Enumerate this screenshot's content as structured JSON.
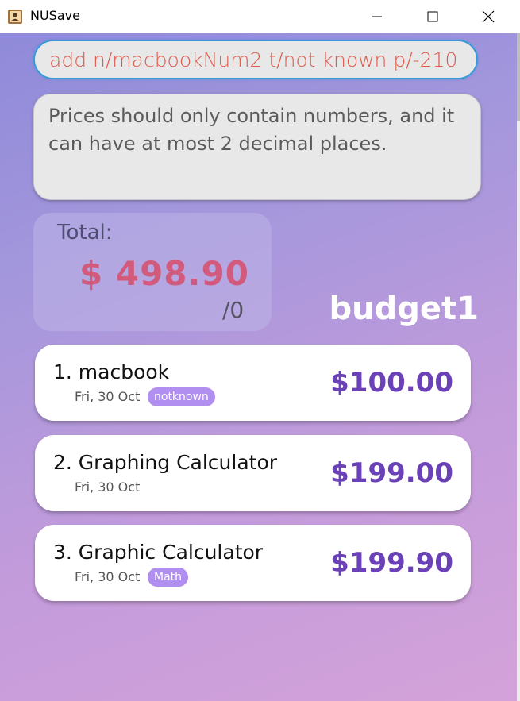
{
  "window": {
    "title": "NUSave",
    "icon": "contact-book-icon",
    "controls": [
      "minimize-icon",
      "maximize-icon",
      "close-icon"
    ]
  },
  "command": {
    "value": "add n/macbookNum2 t/not known p/-210"
  },
  "result": {
    "message": "Prices should only contain numbers, and it can have at most 2 decimal places."
  },
  "summary": {
    "total_label": "Total:",
    "total_amount": "$ 498.90",
    "count": "/0",
    "budget_name": "budget1"
  },
  "items": [
    {
      "name": "1. macbook",
      "date": "Fri, 30 Oct",
      "tag": "notknown",
      "price": "$100.00"
    },
    {
      "name": "2. Graphing Calculator",
      "date": "Fri, 30 Oct",
      "tag": "",
      "price": "$199.00"
    },
    {
      "name": "3. Graphic Calculator",
      "date": "Fri, 30 Oct",
      "tag": "Math",
      "price": "$199.90"
    }
  ],
  "colors": {
    "accent_price": "#6b41b8",
    "total_amount": "#d25a7c",
    "tag_bg": "#b18ff0",
    "command_text": "#e05a4c",
    "command_border": "#3a9ad9"
  }
}
